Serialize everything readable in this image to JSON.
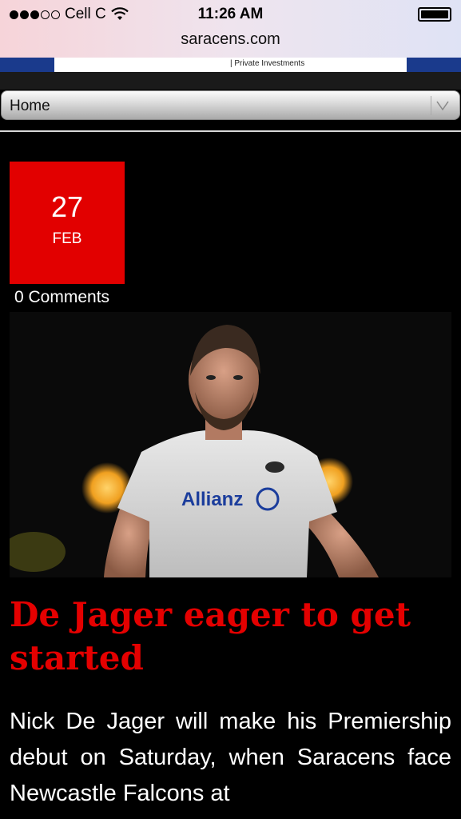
{
  "status_bar": {
    "carrier": "Cell C",
    "time": "11:26 AM"
  },
  "browser": {
    "url": "saracens.com"
  },
  "banner": {
    "text": "| Private Investments"
  },
  "nav": {
    "selected": "Home"
  },
  "post": {
    "day": "27",
    "month": "FEB",
    "comments": "0 Comments",
    "image": {
      "jersey_sponsor": "Allianz"
    },
    "title": "De Jager eager to get started",
    "excerpt": "Nick De Jager will make his Premiership debut on Saturday, when Saracens face Newcastle Falcons at"
  },
  "colors": {
    "accent_red": "#e20000",
    "background": "#000000",
    "banner_blue": "#1a3a8c"
  }
}
